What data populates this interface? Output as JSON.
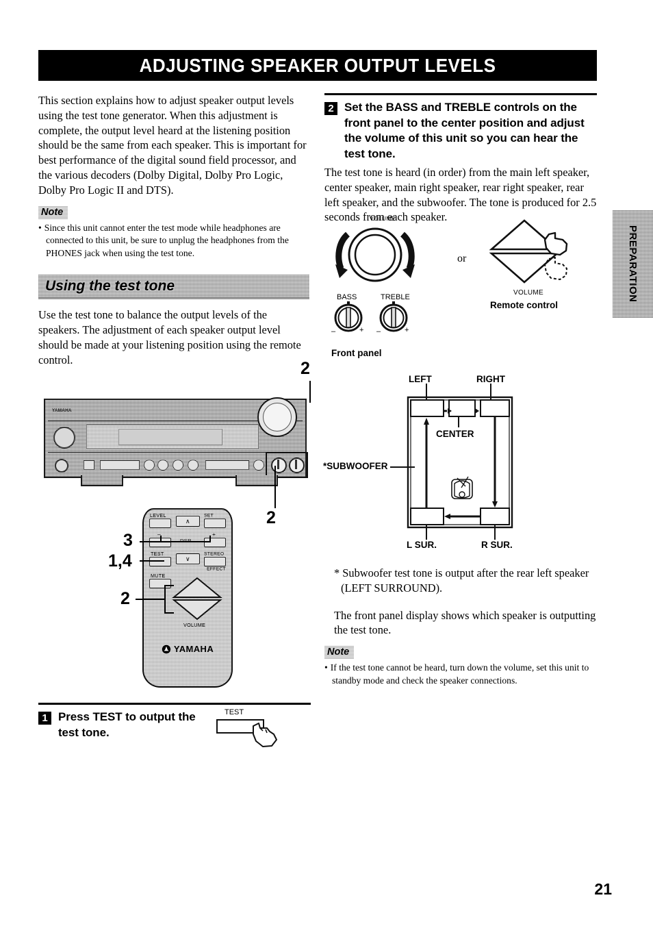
{
  "page": {
    "number": "21",
    "side_tab": "PREPARATION"
  },
  "title": "ADJUSTING SPEAKER OUTPUT LEVELS",
  "left_column": {
    "intro_paragraph": "This section explains how to adjust speaker output levels using the test tone generator. When this adjustment is complete, the output level heard at the listening position should be the same from each speaker. This is important for best performance of the digital sound field processor, and the various decoders (Dolby Digital, Dolby Pro Logic, Dolby Pro Logic II and DTS).",
    "note_label": "Note",
    "note_items": [
      "Since this unit cannot enter the test mode while headphones are connected to this unit, be sure to unplug the headphones from the PHONES jack when using the test tone."
    ],
    "section_heading": "Using the test tone",
    "section_paragraph": "Use the test tone to balance the output levels of the speakers. The adjustment of each speaker output level should be made at your listening position using the remote control.",
    "step1": {
      "number": "1",
      "heading": "Press TEST to output the test tone.",
      "button_label": "TEST"
    }
  },
  "right_column": {
    "step2": {
      "number": "2",
      "heading": "Set the BASS and TREBLE controls on the front panel to the center position and adjust the volume of this unit so you can hear the test tone.",
      "body": "The test tone is heard (in order) from the main left speaker, center speaker, main right speaker, rear right speaker, rear left speaker, and the subwoofer. The tone is produced for 2.5 seconds from each speaker."
    },
    "footnote": "*   Subwoofer test tone is output after the rear left speaker (LEFT SURROUND).",
    "display_paragraph": "The front panel display shows which speaker is outputting the test tone.",
    "note_label": "Note",
    "note_items": [
      "If the test tone cannot be heard, turn down the volume, set this unit to standby mode and check the speaker connections."
    ]
  },
  "figures": {
    "volume_controls": {
      "volume_label": "VOLUME",
      "bass_label": "BASS",
      "treble_label": "TREBLE",
      "minus": "–",
      "plus": "+",
      "front_panel_caption": "Front panel",
      "or_label": "or",
      "remote_volume_label": "VOLUME",
      "remote_caption": "Remote control"
    },
    "receiver": {
      "brand": "YAMAHA",
      "callout_volume": "2",
      "callout_tone": "2"
    },
    "remote": {
      "brand": "YAMAHA",
      "buttons": {
        "level": "LEVEL",
        "set_menu": "SET MENU",
        "dsp": "DSP",
        "dsp_minus": "–",
        "dsp_plus": "+",
        "test": "TEST",
        "stereo": "STEREO",
        "effect": "EFFECT",
        "mute": "MUTE",
        "volume": "VOLUME",
        "up_arrow": "∧",
        "down_arrow": "∨"
      },
      "callouts": {
        "dsp": "3",
        "test": "1,4",
        "volume": "2"
      }
    },
    "speaker_layout": {
      "left": "LEFT",
      "right": "RIGHT",
      "center": "CENTER",
      "subwoofer": "*SUBWOOFER",
      "l_sur": "L SUR.",
      "r_sur": "R SUR."
    }
  }
}
